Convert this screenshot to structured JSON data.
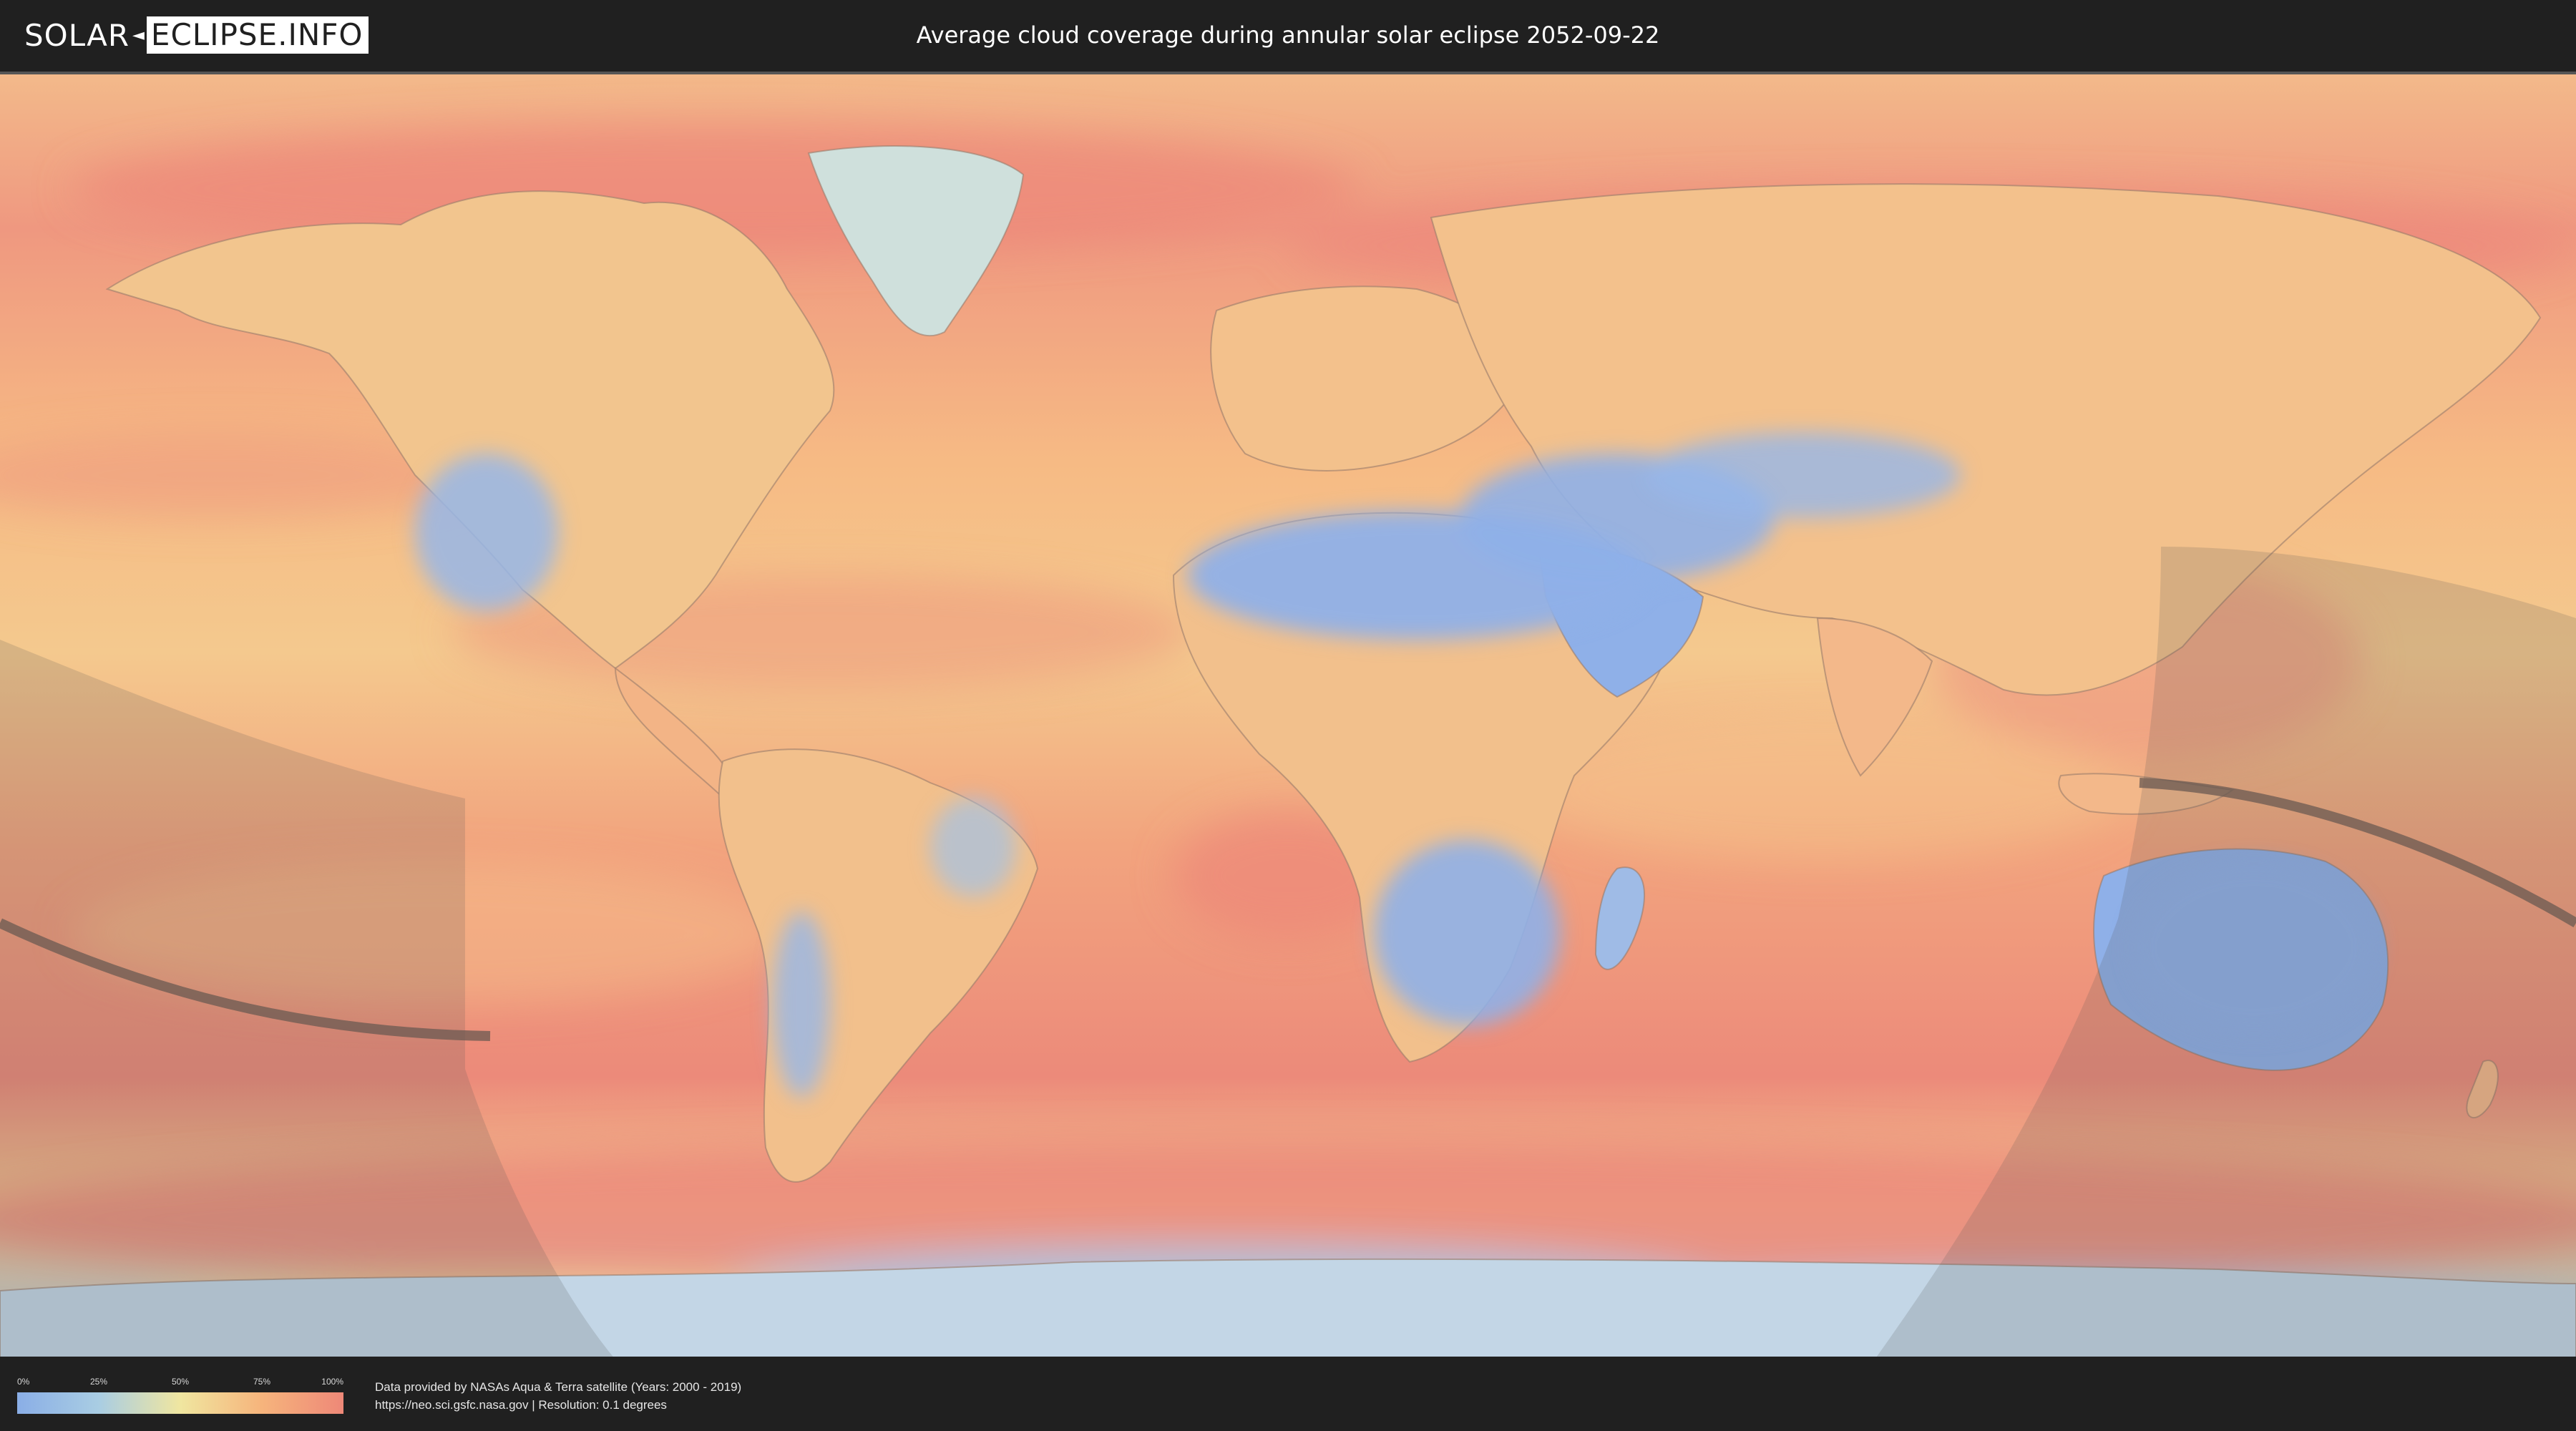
{
  "header": {
    "logo_left": "SOLAR",
    "logo_right": "ECLIPSE.INFO",
    "title": "Average cloud coverage during annular solar eclipse 2052-09-22"
  },
  "map": {
    "layer": "cloud-coverage",
    "ocean_color": "#f4a27c",
    "clear_color": "#8fb0e8",
    "cloudy_color": "#ee8a78",
    "shadow_color": "#555555"
  },
  "legend": {
    "ticks": [
      "0%",
      "25%",
      "50%",
      "75%",
      "100%"
    ],
    "gradient_colors": [
      "#8aaee6",
      "#a9cde3",
      "#f0e6a0",
      "#f6b47c",
      "#ee8878"
    ]
  },
  "footer": {
    "line1": "Data provided by NASAs Aqua & Terra satellite (Years: 2000 - 2019)",
    "line2": "https://neo.sci.gsfc.nasa.gov | Resolution: 0.1 degrees"
  }
}
